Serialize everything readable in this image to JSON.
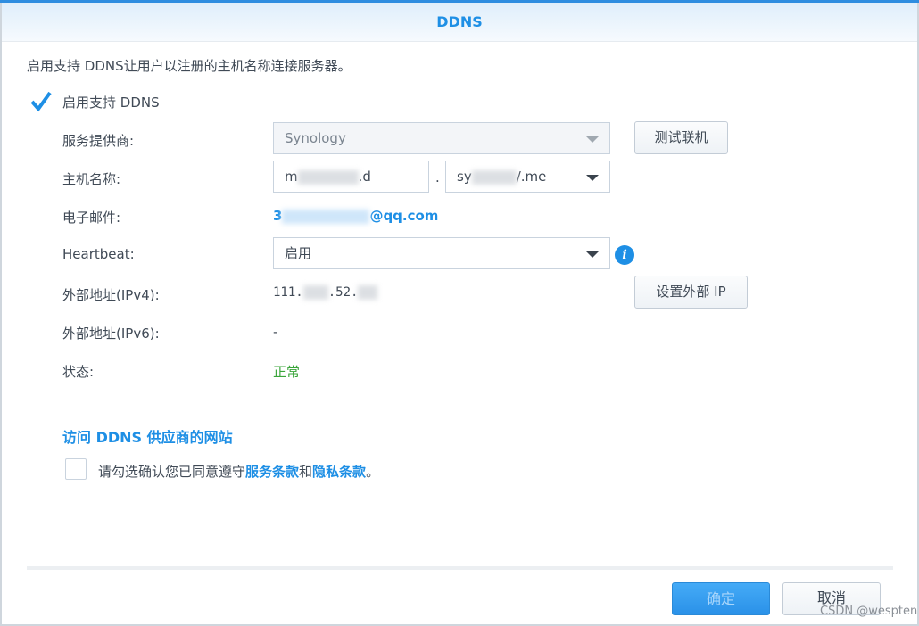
{
  "title": "DDNS",
  "description": "启用支持 DDNS让用户以注册的主机名称连接服务器。",
  "enable_checkbox": {
    "label": "启用支持 DDNS",
    "checked": true
  },
  "labels": {
    "provider": "服务提供商:",
    "hostname": "主机名称:",
    "email": "电子邮件:",
    "heartbeat": "Heartbeat:",
    "ipv4": "外部地址(IPv4):",
    "ipv6": "外部地址(IPv6):",
    "status": "状态:"
  },
  "provider_value": "Synology",
  "test_button": "测试联机",
  "hostname_prefix": "m",
  "hostname_suffix": ".d",
  "dot": ".",
  "domain_prefix": "sy",
  "domain_suffix": "/.me",
  "email_prefix": "3",
  "email_suffix": "@qq.com",
  "heartbeat_value": "启用",
  "ipv4_a": "111.",
  "ipv4_b": ".52.",
  "set_ip_button": "设置外部 IP",
  "ipv6_value": "-",
  "status_value": "正常",
  "status_color": "#3aa53a",
  "visit_link": "访问 DDNS 供应商的网站",
  "agree": {
    "prefix": "请勾选确认您已同意遵守",
    "terms": "服务条款",
    "and": "和",
    "privacy": "隐私条款",
    "end": "。",
    "checked": false
  },
  "ok_button": "确定",
  "cancel_button": "取消",
  "watermark": "CSDN @wespten"
}
